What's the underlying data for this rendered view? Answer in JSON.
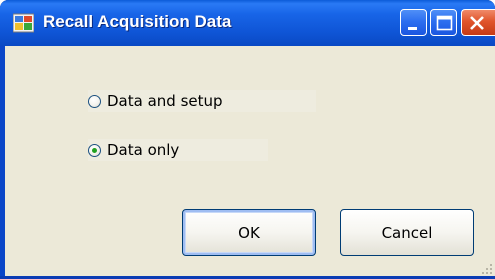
{
  "window": {
    "title": "Recall Acquisition Data",
    "icon": "app-icon",
    "controls": {
      "minimize": "minimize-icon",
      "maximize": "maximize-icon",
      "close": "close-icon"
    }
  },
  "options": [
    {
      "label": "Data and setup",
      "selected": false
    },
    {
      "label": "Data only",
      "selected": true
    }
  ],
  "buttons": {
    "ok_label": "OK",
    "cancel_label": "Cancel"
  },
  "colors": {
    "titlebar": "#1865e8",
    "client_bg": "#ece9d8",
    "close_button": "#e0552c",
    "radio_selected": "#21a121"
  }
}
